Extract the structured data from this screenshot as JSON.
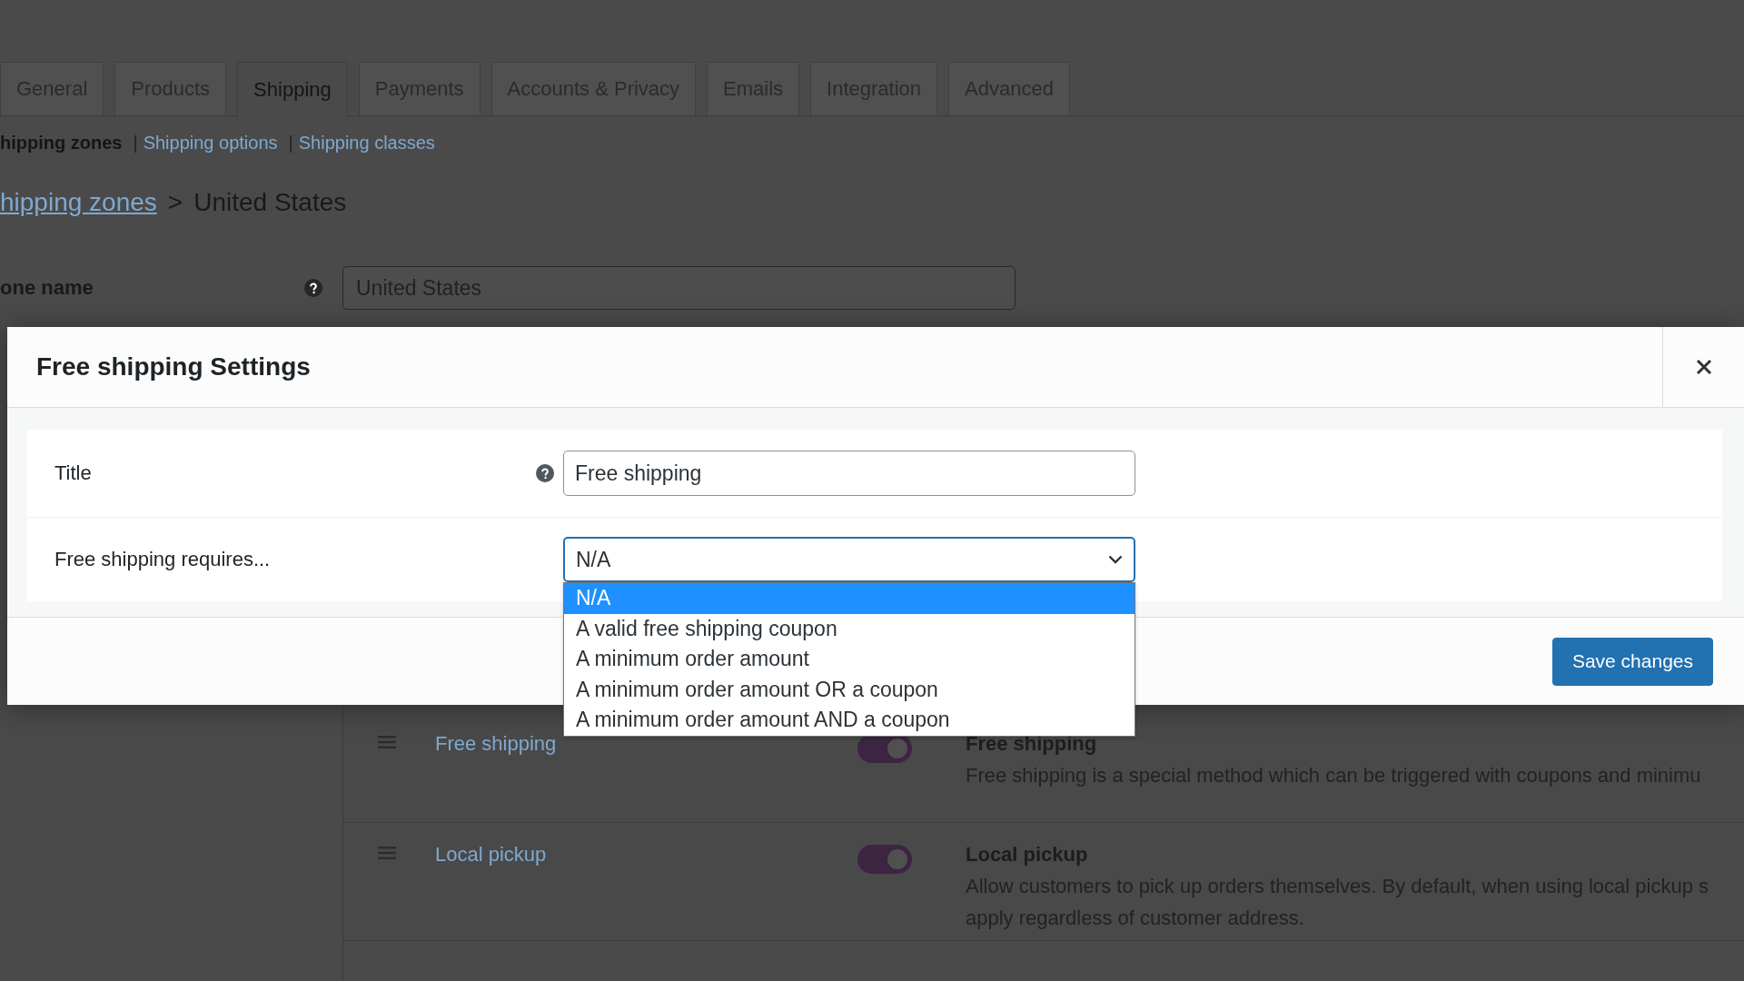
{
  "tabs": [
    {
      "label": "General",
      "selected": false
    },
    {
      "label": "Products",
      "selected": false
    },
    {
      "label": "Shipping",
      "selected": true
    },
    {
      "label": "Payments",
      "selected": false
    },
    {
      "label": "Accounts & Privacy",
      "selected": false
    },
    {
      "label": "Emails",
      "selected": false
    },
    {
      "label": "Integration",
      "selected": false
    },
    {
      "label": "Advanced",
      "selected": false
    }
  ],
  "subnav": [
    {
      "label": "hipping zones",
      "selected": true
    },
    {
      "prefix": "|",
      "label": "Shipping options",
      "selected": false
    },
    {
      "prefix": "|",
      "label": "Shipping classes",
      "selected": false
    }
  ],
  "breadcrumb": {
    "link": "hipping zones",
    "separator": ">",
    "current": "United States"
  },
  "zone_name": {
    "label": "one name",
    "value": "United States"
  },
  "shipping_methods": [
    {
      "name": "Free shipping",
      "enabled": true,
      "title": "Free shipping",
      "description": "Free shipping is a special method which can be triggered with coupons and minimu"
    },
    {
      "name": "Local pickup",
      "enabled": true,
      "title": "Local pickup",
      "description": "Allow customers to pick up orders themselves. By default, when using local pickup s apply regardless of customer address."
    }
  ],
  "modal": {
    "title": "Free shipping Settings",
    "fields": [
      {
        "kind": "text",
        "label": "Title",
        "help": true,
        "value": "Free shipping"
      },
      {
        "kind": "select",
        "label": "Free shipping requires...",
        "help": false,
        "value": "N/A",
        "expanded": true,
        "options": [
          {
            "label": "N/A",
            "selected": true
          },
          {
            "label": "A valid free shipping coupon",
            "selected": false
          },
          {
            "label": "A minimum order amount",
            "selected": false
          },
          {
            "label": "A minimum order amount OR a coupon",
            "selected": false
          },
          {
            "label": "A minimum order amount AND a coupon",
            "selected": false
          }
        ]
      }
    ],
    "save_button": "Save changes"
  }
}
